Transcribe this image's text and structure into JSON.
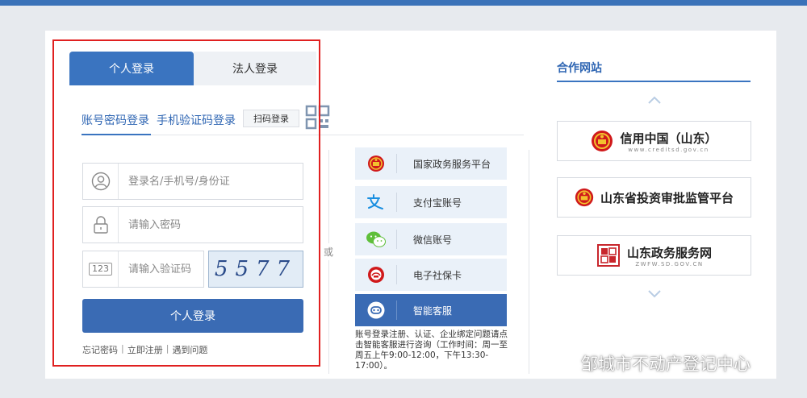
{
  "tabs": {
    "personal": "个人登录",
    "corporate": "法人登录"
  },
  "modes": {
    "account": "账号密码登录",
    "phone": "手机验证码登录",
    "scan": "扫码登录"
  },
  "fields": {
    "username_placeholder": "登录名/手机号/身份证",
    "password_placeholder": "请输入密码",
    "code_placeholder": "请输入验证码",
    "code_icon_text": "123"
  },
  "captcha": "5577",
  "login_button": "个人登录",
  "links": {
    "forgot": "忘记密码",
    "register": "立即注册",
    "help": "遇到问题",
    "sep": "|"
  },
  "or_label": "或",
  "services": [
    {
      "label": "国家政务服务平台",
      "icon": "national-emblem-icon"
    },
    {
      "label": "支付宝账号",
      "icon": "alipay-icon"
    },
    {
      "label": "微信账号",
      "icon": "wechat-icon"
    },
    {
      "label": "电子社保卡",
      "icon": "social-security-icon"
    },
    {
      "label": "智能客服",
      "icon": "customer-service-icon"
    }
  ],
  "service_note": "账号登录注册、认证、企业绑定问题请点击智能客服进行咨询（工作时间：周一至周五上午9:00-12:00，下午13:30-17:00）。",
  "partners": {
    "title": "合作网站",
    "items": [
      {
        "name": "信用中国（山东）",
        "sub": "www.creditsd.gov.cn"
      },
      {
        "name": "山东省投资审批监管平台",
        "sub": ""
      },
      {
        "name": "山东政务服务网",
        "sub": "ZWFW.SD.GOV.CN"
      }
    ]
  },
  "watermark": "邹城市不动产登记中心",
  "colors": {
    "primary": "#3a6bb4",
    "highlight_box": "#e02020",
    "emblem_red": "#d0191b",
    "emblem_gold": "#f2c12e"
  }
}
